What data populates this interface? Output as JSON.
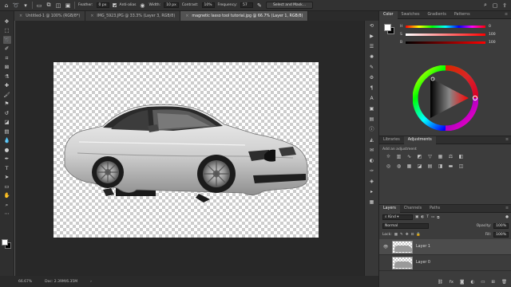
{
  "options_bar": {
    "feather_label": "Feather:",
    "feather_value": "0 px",
    "antialias_label": "Anti-alias",
    "width_label": "Width:",
    "width_value": "10 px",
    "contrast_label": "Contrast:",
    "contrast_value": "10%",
    "frequency_label": "Frequency:",
    "frequency_value": "57",
    "select_mask_label": "Select and Mask..."
  },
  "tabs": [
    {
      "label": "Untitled-1 @ 100% (RGB/8*)",
      "active": false
    },
    {
      "label": "IMG_5923.JPG @ 33.3% (Layer 3, RGB/8)",
      "active": false
    },
    {
      "label": "magnetic lasso tool tutorial.jpg @ 66.7% (Layer 1, RGB/8)",
      "active": true
    }
  ],
  "tools": [
    "move-tool",
    "marquee-tool",
    "lasso-tool",
    "quick-select-tool",
    "crop-tool",
    "frame-tool",
    "eyedropper-tool",
    "healing-brush-tool",
    "brush-tool",
    "clone-stamp-tool",
    "history-brush-tool",
    "eraser-tool",
    "gradient-tool",
    "blur-tool",
    "dodge-tool",
    "pen-tool",
    "type-tool",
    "path-selection-tool",
    "rectangle-tool",
    "hand-tool",
    "zoom-tool",
    "more-tools"
  ],
  "status": {
    "zoom": "66.67%",
    "doc_size": "Doc: 2.39M/6.35M"
  },
  "color_panel": {
    "tabs": [
      "Color",
      "Swatches",
      "Gradients",
      "Patterns"
    ],
    "sliders": [
      {
        "label": "H",
        "value": "0"
      },
      {
        "label": "S",
        "value": "100"
      },
      {
        "label": "B",
        "value": "100"
      }
    ],
    "accent": "#ff0000"
  },
  "adjustments_panel": {
    "tabs": [
      "Libraries",
      "Adjustments"
    ],
    "hint": "Add an adjustment"
  },
  "layers_panel": {
    "tabs": [
      "Layers",
      "Channels",
      "Paths"
    ],
    "kind_label": "Kind",
    "blend_mode": "Normal",
    "opacity_label": "Opacity:",
    "opacity_value": "100%",
    "lock_label": "Lock:",
    "fill_label": "Fill:",
    "fill_value": "100%",
    "layers": [
      {
        "name": "Layer 1",
        "visible": true,
        "active": true
      },
      {
        "name": "Layer 0",
        "visible": false,
        "active": false
      }
    ]
  }
}
